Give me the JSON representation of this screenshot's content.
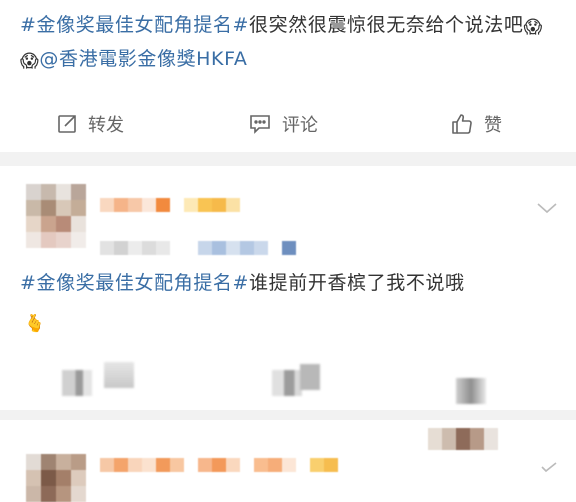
{
  "post": {
    "topic": "#金像奖最佳女配角提名#",
    "text": "很突然很震惊很无奈给个说法吧",
    "emoji_1": "😱",
    "emoji_2": "😱",
    "mention": "@香港電影金像獎HKFA"
  },
  "actions": {
    "repost_label": "转发",
    "comment_label": "评论",
    "like_label": "赞",
    "repost_icon": "repost-icon",
    "comment_icon": "comment-icon",
    "like_icon": "thumbs-up-icon"
  },
  "comment": {
    "topic": "#金像奖最佳女配角提名#",
    "text": "谁提前开香槟了我不说哦",
    "emoji": "🫰"
  },
  "colors": {
    "link": "#3a6ea5",
    "text": "#333333",
    "muted": "#666666",
    "separator": "#f2f2f2"
  }
}
